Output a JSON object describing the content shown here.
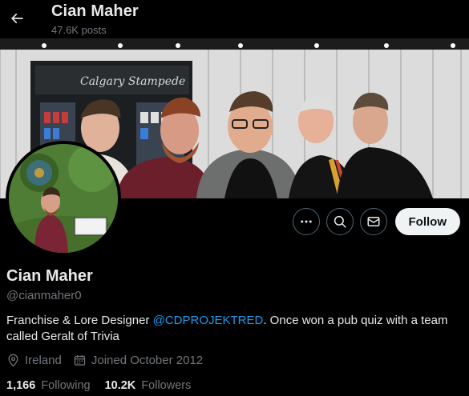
{
  "header": {
    "name": "Cian Maher",
    "post_count": "47.6K posts"
  },
  "banner": {
    "stand_sign": "Calgary Stampede",
    "people": [
      "person-1",
      "person-2",
      "person-3",
      "person-4",
      "person-5"
    ]
  },
  "profile": {
    "display_name": "Cian Maher",
    "handle": "@cianmaher0",
    "bio_prefix": "Franchise & Lore Designer ",
    "bio_mention": "@CDPROJEKTRED",
    "bio_suffix": ". Once won a pub quiz with a team called Geralt of Trivia",
    "location": "Ireland",
    "joined": "Joined October 2012"
  },
  "actions": {
    "follow_label": "Follow"
  },
  "stats": {
    "following_count": "1,166",
    "following_label": "Following",
    "followers_count": "10.2K",
    "followers_label": "Followers"
  },
  "colors": {
    "background": "#000000",
    "text_primary": "#e7e9ea",
    "text_secondary": "#71767b",
    "link": "#1d9bf0",
    "follow_button_bg": "#eff3f4"
  },
  "icons": [
    "arrow-left-icon",
    "more-icon",
    "search-icon",
    "mail-icon",
    "location-pin-icon",
    "calendar-icon"
  ]
}
